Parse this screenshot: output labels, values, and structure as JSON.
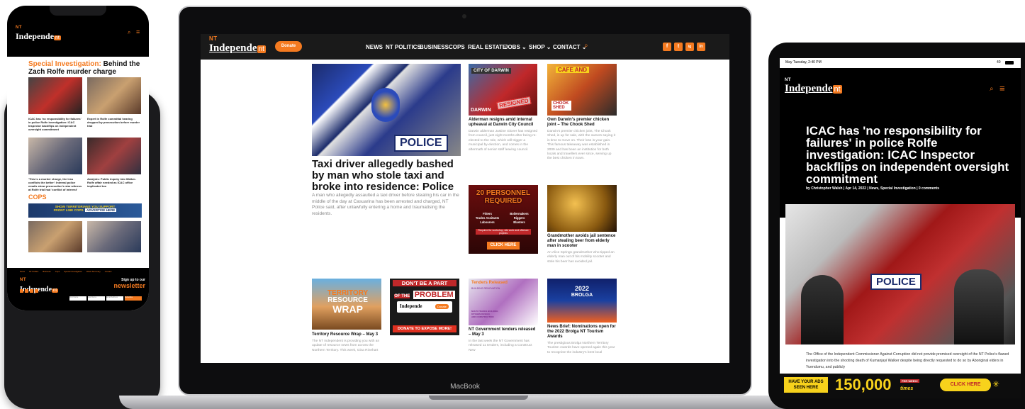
{
  "brand": {
    "nt": "NT",
    "name": "Independe",
    "logo_box": "nt"
  },
  "phone": {
    "section_title_orange": "Special Investigation:",
    "section_title_black": "Behind the Zach Rolfe murder charge",
    "cards": [
      {
        "title": "ICAC has 'no responsibility for failures' in police Rolfe investigation: ICAC Inspector backflips on independent oversight commitment"
      },
      {
        "title": "Expert in Rolfe committal hearing dropped by prosecution before murder trial"
      },
      {
        "title": "'This is a murder charge, the less conflicts the better': Internal police emails show prosecution's star witness at Rolfe trial had 'conflict of interest'"
      },
      {
        "title": "Analysis: Public inquiry into Walker-Rolfe affair needed as ICAC office implicated too"
      }
    ],
    "cops_label": "COPS",
    "banner_line1": "SHOW TERRITORIANS YOU SUPPORT",
    "banner_line2": "FRONT LINE COPS.",
    "banner_cta": "ADVERTISE HERE",
    "footer_links": [
      "News",
      "NT Politics",
      "Business",
      "Cops",
      "Special Investigation",
      "Week Summary",
      "Contact"
    ],
    "signup": "Sign up to our",
    "newsletter": "newsletter",
    "inputs": [
      "First Name",
      "Last Name",
      "Email Address"
    ],
    "subscribe": "Subscribe"
  },
  "laptop": {
    "donate": "Donate",
    "nav": [
      "NEWS",
      "NT POLITICS",
      "BUSINESS",
      "COPS",
      "REAL ESTATE",
      "JOBS ⌄",
      "SHOP ⌄",
      "CONTACT ⌄"
    ],
    "search_icon": "search-icon",
    "social": [
      "f",
      "t",
      "ig",
      "in"
    ],
    "hero_title": "Taxi driver allegedly bashed by man who stole taxi and broke into residence: Police",
    "hero_excerpt": "A man who allegedly assaulted a taxi driver before stealing his car in the middle of the day at Casuarina has been arrested and charged, NT Police said, after unlawfully entering a home and traumatising the residents.",
    "hero_img_text": "POLICE",
    "art1_title": "Alderman resigns amid internal upheaval at Darwin City Council",
    "art1_excerpt": "Darwin alderman Justine Glover has resigned from council, just eight months after being re-elected to the role, which will trigger a municipal by-election, and comes in the aftermath of senior staff leaving council.",
    "art1_img_top": "CITY OF DARWIN",
    "art1_img_stamp": "RESIGNED",
    "art1_img_bottom": "DARWIN",
    "art2_title": "Own Darwin's premier chicken joint – The Chook Shed",
    "art2_excerpt": "Darwin's premier chicken joint, The Chook Shed, is up for sale, with the owners saying it is time to move on. Their loss is your gain. This famous takeaway was established in 2009 and has been an institution for both locals and travellers ever since, serving up the best chicken in town.",
    "art2_img_top": "CAFE AND",
    "art2_img_bottom": "CHOOK SHED",
    "ad_job_title": "20 PERSONNEL REQUIRED",
    "ad_job_roles": [
      "Fitters",
      "Boilermakers",
      "Trades Assitants",
      "Riggers",
      "Labourers",
      "Blasters"
    ],
    "ad_job_note": "Required for workshop, site work and offshore projects",
    "ad_job_cta": "CLICK HERE",
    "art3_title": "Grandmother avoids jail sentence after stealing beer from elderly man in scooter",
    "art3_excerpt": "An Alice Springs grandmother who tipped an elderly man out of his mobility scooter and stole his beer has avoided jail.",
    "art4_title": "Territory Resource Wrap – May 3",
    "art4_excerpt": "The NT Independent is providing you with an update of resource news from across the Northern Territory. This week, Gina Rinehart",
    "art4_img": [
      "TERRITORY",
      "RESOURCE",
      "WRAP"
    ],
    "ad_dont_1": "DON'T BE A PART",
    "ad_dont_2": "OF THE",
    "ad_dont_3": "PROBLEM",
    "ad_dont_cta": "DONATE TO EXPOSE MORE!",
    "ad_dont_btn": "Donate",
    "art5_title": "NT Government tenders released – May 3",
    "art5_excerpt": "In the last week the NT Government has released 11 tenders, including a Construct New",
    "art5_img_head": "Tenders Released",
    "art5_img_sub": "BUILDING RENOVATION",
    "art5_img_list": [
      "MULTI-TRADES BUILDING",
      "KITCHEN DESIGN",
      "AND CONSTRUCTION"
    ],
    "art6_title": "News Brief: Nominations open for the 2022 Brolga NT Tourism Awards",
    "art6_excerpt": "The prestigious Brolga Northern Territory Tourism Awards have opened again this year to recognise the industry's best local",
    "art6_img": [
      "2022",
      "BROLGA"
    ],
    "macbook": "MacBook"
  },
  "tablet": {
    "status_time": "May Tuesday, 2:40 PM",
    "status_right": "40",
    "title": "ICAC has 'no responsibility for failures' in police Rolfe investigation: ICAC Inspector backflips on independent oversight commitment",
    "byline": "by Christopher Walsh | Apr 14, 2022 | News, Special Investigation | 0 comments",
    "body": "The Office of the Independent Commissioner Against Corruption did not provide promised oversight of the NT Police's flawed investigation into the shooting death of Kumanjayi Walker despite being directly requested to do so by Aboriginal elders in Yuendumu, and publicly",
    "img_text": "POLICE",
    "ad_left": "HAVE YOUR ADS SEEN HERE",
    "ad_number": "150,000",
    "ad_per": "PER WEEK!",
    "ad_times": "times",
    "ad_cta": "CLICK HERE",
    "menu_icon": "hamburger-icon"
  },
  "colors": {
    "accent": "#f47a20",
    "dark": "#000000"
  }
}
